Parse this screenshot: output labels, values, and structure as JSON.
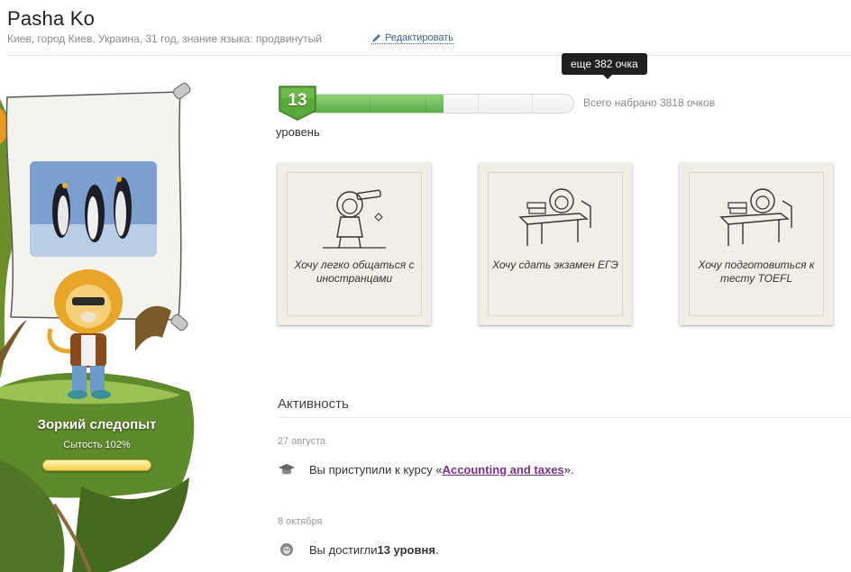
{
  "profile": {
    "name": "Pasha Ko",
    "info": "Киев, город Киев, Украина, 31 год, знание языка: продвинутый",
    "edit_label": "Редактировать"
  },
  "mascot": {
    "status_title": "Зоркий следопыт",
    "satiety": "Сытость 102%",
    "satiety_percent": 102,
    "photo_subject": "penguins"
  },
  "level": {
    "number": "13",
    "caption": "уровень",
    "progress_fraction": 0.5,
    "total_text": "Всего набрано 3818 очков",
    "tooltip": "еще 382 очка"
  },
  "goals": [
    {
      "text": "Хочу легко общаться с иностранцами",
      "icon": "lion-telescope-icon"
    },
    {
      "text": "Хочу сдать экзамен ЕГЭ",
      "icon": "lion-desk-icon"
    },
    {
      "text": "Хочу подготовиться к тесту TOEFL",
      "icon": "lion-desk-icon"
    }
  ],
  "activity": {
    "title": "Активность",
    "entries": [
      {
        "date": "27 августа",
        "prefix": "Вы приступили к курсу «",
        "link": "Accounting and taxes",
        "suffix": "».",
        "icon": "graduation-cap-icon"
      },
      {
        "date": "8 октября",
        "prefix": "Вы достигли ",
        "bold": "13 уровня",
        "suffix": ".",
        "icon": "lion-face-icon"
      }
    ]
  },
  "colors": {
    "progress_green": "#5ab04a",
    "link_purple": "#7b2f86",
    "tooltip_bg": "#1f1f1f",
    "card_bg": "#f1eee7"
  }
}
